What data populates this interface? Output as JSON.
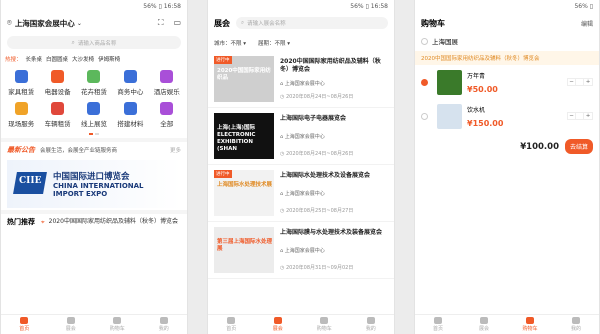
{
  "status": {
    "left": "56% ▯ 16:58",
    "mid": "56% ▯ 16:58",
    "right": "56% ▯"
  },
  "phone1": {
    "title": "上海国家会展中心",
    "search_placeholder": "请输入商品名称",
    "hot_label": "热搜：",
    "hot_items": [
      "长条桌",
      "白圆圆桌",
      "大沙发椅",
      "伊姆斯椅"
    ],
    "grid": [
      {
        "label": "家具租赁",
        "color": "#3b6fd8"
      },
      {
        "label": "电器设备",
        "color": "#f05a28"
      },
      {
        "label": "花卉租赁",
        "color": "#5cb85c"
      },
      {
        "label": "商务中心",
        "color": "#3b6fd8"
      },
      {
        "label": "酒店娱乐",
        "color": "#a94fd8"
      },
      {
        "label": "现场服务",
        "color": "#f0a328"
      },
      {
        "label": "车辆租赁",
        "color": "#e0483b"
      },
      {
        "label": "线上展览",
        "color": "#3b6fd8"
      },
      {
        "label": "搭建材料",
        "color": "#3b6fd8"
      },
      {
        "label": "全部",
        "color": "#a94fd8"
      }
    ],
    "notice_label": "最新公告",
    "notice_text": "会展生活，会展全产业链服务商",
    "notice_more": "更多",
    "banner": {
      "cn": "中国国际进口博览会",
      "en1": "CHINA INTERNATIONAL",
      "en2": "IMPORT EXPO",
      "logo_text": "CIIE"
    },
    "hot_rec_label": "热门推荐",
    "hot_rec_text": "2020中国国际家用纺织品及辅料（秋冬）博览会",
    "tabs": [
      "首页",
      "展会",
      "购物车",
      "我的"
    ]
  },
  "phone2": {
    "title": "展会",
    "search_placeholder": "请输入展会名称",
    "filter_city": "城市：不限 ▾",
    "filter_time": "届期：不限 ▾",
    "expos": [
      {
        "tag": "进行中",
        "thumb_text": "2020中国国际家用纺织品",
        "thumb_bg": "#cfcfcf",
        "thumb_color": "#ffffff",
        "title": "2020中国国际家用纺织品及辅料（秋冬）博览会",
        "venue": "上海国家会展中心",
        "date": "2020年08月24日~08月26日"
      },
      {
        "tag": "",
        "thumb_text": "上海(上海)国际 ELECTRONIC EXHIBITION (SHAN",
        "thumb_bg": "#111111",
        "thumb_color": "#ffffff",
        "title": "上海国际电子电器展览会",
        "venue": "上海国家会展中心",
        "date": "2020年08月24日~08月26日"
      },
      {
        "tag": "进行中",
        "thumb_text": "上海国际水处理技术展",
        "thumb_bg": "#f2f2f2",
        "thumb_color": "#e08a23",
        "title": "上海国际水处理技术及设备展览会",
        "venue": "上海国家会展中心",
        "date": "2020年08月25日~08月27日"
      },
      {
        "tag": "",
        "thumb_text": "第三届上海国际水处理展",
        "thumb_bg": "#ececec",
        "thumb_color": "#f05a28",
        "title": "上海国际膜与水处理技术及装备展览会",
        "venue": "上海国家会展中心",
        "date": "2020年08月31日~09月02日"
      }
    ],
    "tabs": [
      "首页",
      "展会",
      "购物车",
      "我的"
    ]
  },
  "phone3": {
    "title": "购物车",
    "edit": "编辑",
    "shop_name": "上海国展",
    "note": "2020中国国际家用纺织品及辅料（秋冬）博览会",
    "items": [
      {
        "name": "万年青",
        "price": "¥50.00",
        "color": "#3a7a2a",
        "checked": true
      },
      {
        "name": "饮水机",
        "price": "¥150.00",
        "color": "#d6e2ee",
        "checked": false
      }
    ],
    "total": "¥100.00",
    "checkout": "去结算",
    "tabs": [
      "首页",
      "展会",
      "购物车",
      "我的"
    ]
  }
}
